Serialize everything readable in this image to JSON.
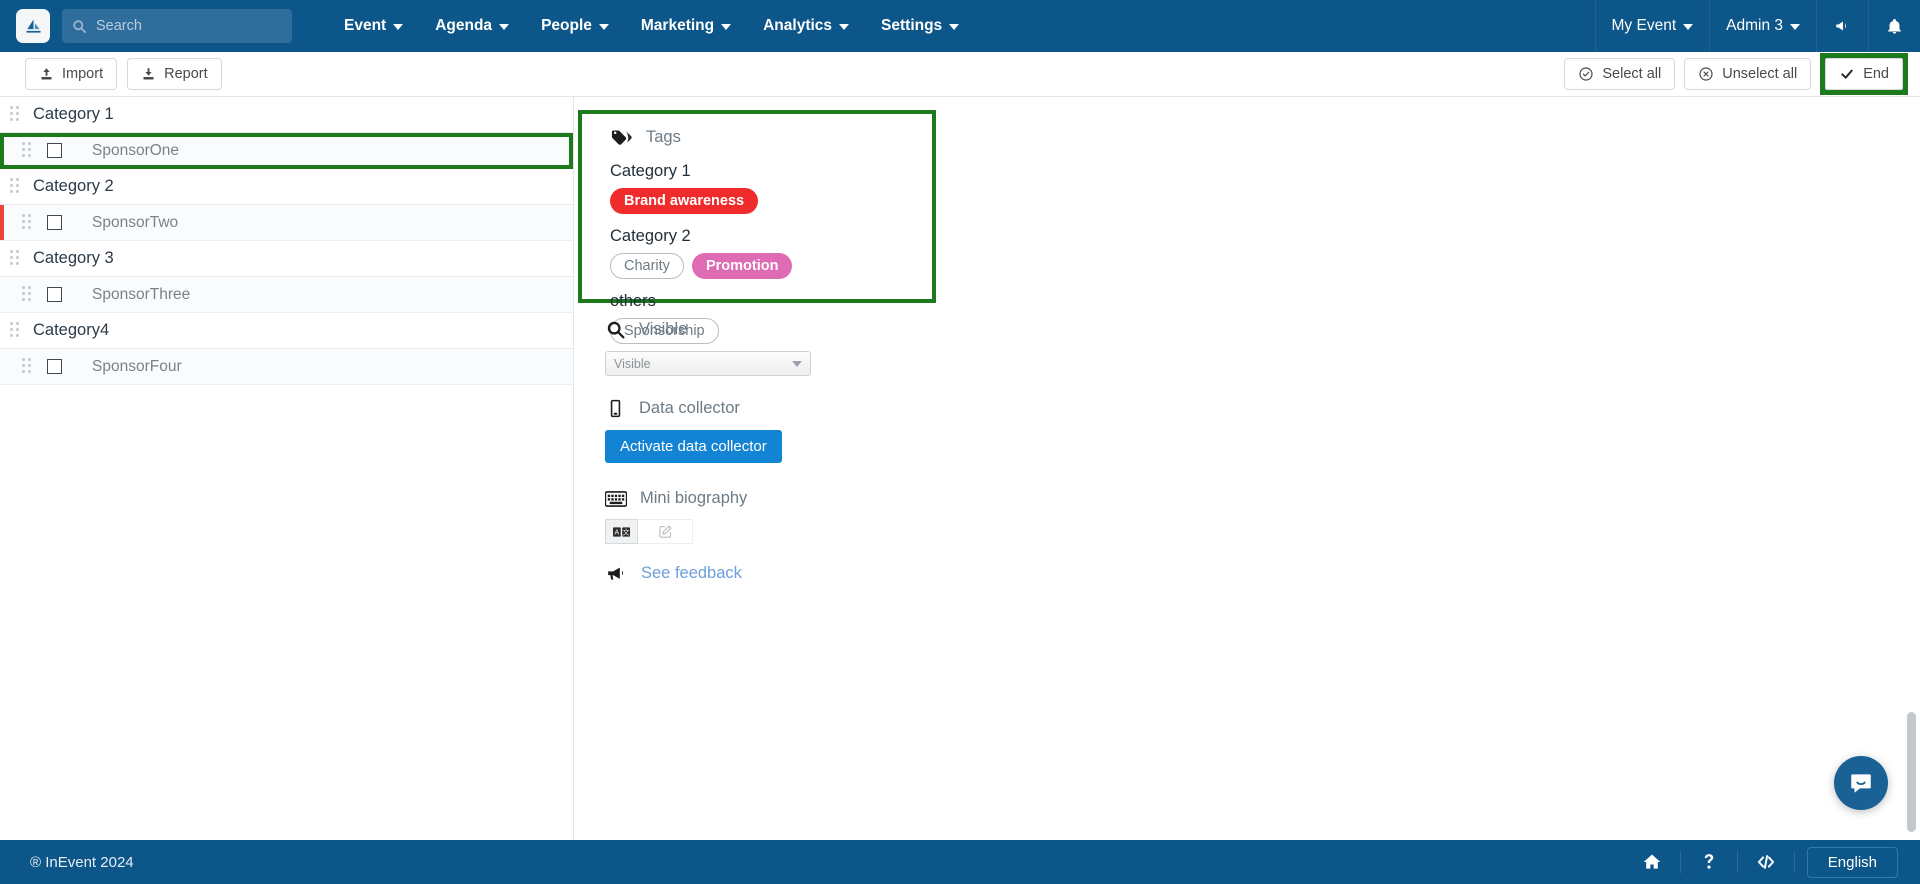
{
  "navbar": {
    "logo_icon": "inevent-logo-icon",
    "search": {
      "placeholder": "Search",
      "value": "",
      "icon": "search-icon"
    },
    "menu": [
      {
        "label": "Event",
        "icon": "chevron-down-icon"
      },
      {
        "label": "Agenda",
        "icon": "chevron-down-icon"
      },
      {
        "label": "People",
        "icon": "chevron-down-icon"
      },
      {
        "label": "Marketing",
        "icon": "chevron-down-icon"
      },
      {
        "label": "Analytics",
        "icon": "chevron-down-icon"
      },
      {
        "label": "Settings",
        "icon": "chevron-down-icon"
      }
    ],
    "right": [
      {
        "label": "My Event",
        "icon": "chevron-down-icon"
      },
      {
        "label": "Admin 3",
        "icon": "chevron-down-icon"
      }
    ],
    "icons": [
      "megaphone-icon",
      "bell-icon"
    ],
    "bg_color": "#0d5689"
  },
  "toolbar": {
    "import_label": "Import",
    "report_label": "Report",
    "select_all_label": "Select all",
    "unselect_all_label": "Unselect all",
    "end_label": "End",
    "end_highlight_color": "#1c7a1c"
  },
  "sponsor_list": {
    "groups": [
      {
        "category": "Category 1",
        "sponsors": [
          {
            "name": "SponsorOne",
            "checked": false,
            "highlighted": true,
            "red_mark": false
          }
        ]
      },
      {
        "category": "Category 2",
        "sponsors": [
          {
            "name": "SponsorTwo",
            "checked": false,
            "highlighted": false,
            "red_mark": true
          }
        ]
      },
      {
        "category": "Category 3",
        "sponsors": [
          {
            "name": "SponsorThree",
            "checked": false,
            "highlighted": false,
            "red_mark": false
          }
        ]
      },
      {
        "category": "Category4",
        "sponsors": [
          {
            "name": "SponsorFour",
            "checked": false,
            "highlighted": false,
            "red_mark": false
          }
        ]
      }
    ]
  },
  "detail": {
    "tags": {
      "title": "Tags",
      "icon": "tag-icon",
      "highlight_color": "#1c7a1c",
      "groups": [
        {
          "label": "Category 1",
          "pills": [
            {
              "text": "Brand awareness",
              "style": "solid",
              "color": "#ef2b2b"
            }
          ]
        },
        {
          "label": "Category 2",
          "pills": [
            {
              "text": "Charity",
              "style": "outline",
              "color": "#b9bfc4"
            },
            {
              "text": "Promotion",
              "style": "solid",
              "color": "#de6bb3"
            }
          ]
        },
        {
          "label": "others",
          "pills": [
            {
              "text": "Sponsorship",
              "style": "outline",
              "color": "#b9bfc4"
            }
          ]
        }
      ]
    },
    "visible": {
      "title": "Visible",
      "icon": "magnifier-icon",
      "selected": "Visible",
      "options": [
        "Visible"
      ]
    },
    "data_collector": {
      "title": "Data collector",
      "icon": "mobile-icon",
      "button_label": "Activate data collector",
      "button_color": "#1383d4"
    },
    "mini_biography": {
      "title": "Mini biography",
      "icon": "keyboard-icon",
      "translate_icon": "translate-icon",
      "edit_icon": "edit-pencil-icon"
    },
    "feedback": {
      "title": "See feedback",
      "icon": "megaphone-icon"
    }
  },
  "footer": {
    "copyright": "® InEvent 2024",
    "icons": [
      "home-icon",
      "question-icon",
      "code-icon"
    ],
    "language_label": "English",
    "bg_color": "#0d5689"
  },
  "chat": {
    "icon": "chat-bubble-icon",
    "color": "#1a6296"
  }
}
